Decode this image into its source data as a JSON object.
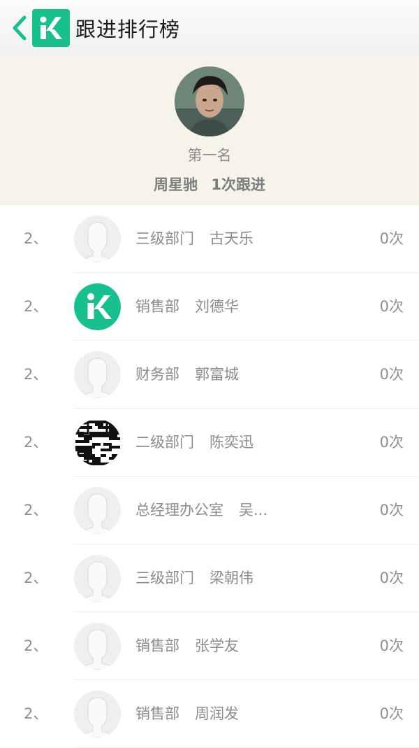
{
  "header": {
    "title": "跟进排行榜",
    "back_icon": "back-arrow-icon",
    "logo_icon": "k-logo-icon",
    "accent": "#19c08f"
  },
  "top": {
    "rank_label": "第一名",
    "name": "周星驰",
    "count_text": "1次跟进"
  },
  "rows": [
    {
      "rank": "2、",
      "dept": "三级部门",
      "name": "古天乐",
      "count": "0次",
      "avatar": "default"
    },
    {
      "rank": "2、",
      "dept": "销售部",
      "name": "刘德华",
      "count": "0次",
      "avatar": "logo"
    },
    {
      "rank": "2、",
      "dept": "财务部",
      "name": "郭富城",
      "count": "0次",
      "avatar": "default"
    },
    {
      "rank": "2、",
      "dept": "二级部门",
      "name": "陈奕迅",
      "count": "0次",
      "avatar": "qr"
    },
    {
      "rank": "2、",
      "dept": "总经理办公室",
      "name": "吴...",
      "count": "0次",
      "avatar": "default"
    },
    {
      "rank": "2、",
      "dept": "三级部门",
      "name": "梁朝伟",
      "count": "0次",
      "avatar": "default"
    },
    {
      "rank": "2、",
      "dept": "销售部",
      "name": "张学友",
      "count": "0次",
      "avatar": "default"
    },
    {
      "rank": "2、",
      "dept": "销售部",
      "name": "周润发",
      "count": "0次",
      "avatar": "default"
    }
  ]
}
